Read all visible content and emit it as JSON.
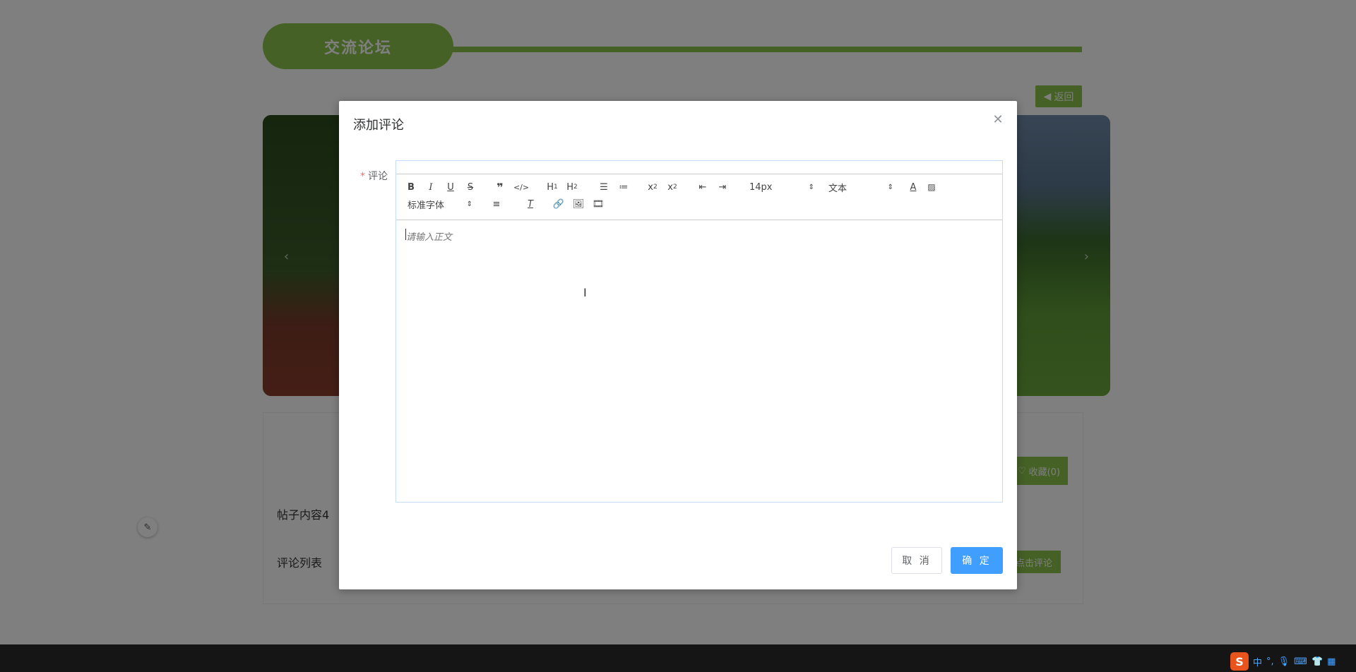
{
  "header": {
    "title": "交流论坛",
    "back_label": "返回"
  },
  "post": {
    "favorite_label": "收藏(0)",
    "content": "帖子内容4",
    "comment_list_label": "评论列表",
    "click_comment_label": "点击评论"
  },
  "dialog": {
    "title": "添加评论",
    "close_icon": "close-icon",
    "field_label": "评论",
    "required_mark": "*",
    "editor": {
      "font_size": "14px",
      "paragraph_format": "文本",
      "font_family": "标准字体",
      "placeholder": "请输入正文"
    },
    "cancel_label": "取 消",
    "ok_label": "确 定"
  },
  "taskbar": {
    "ime_logo": "S",
    "ime_mode": "中",
    "ime_punct": "°,"
  },
  "colors": {
    "accent_green": "#8bc34a",
    "primary_blue": "#409eff"
  }
}
